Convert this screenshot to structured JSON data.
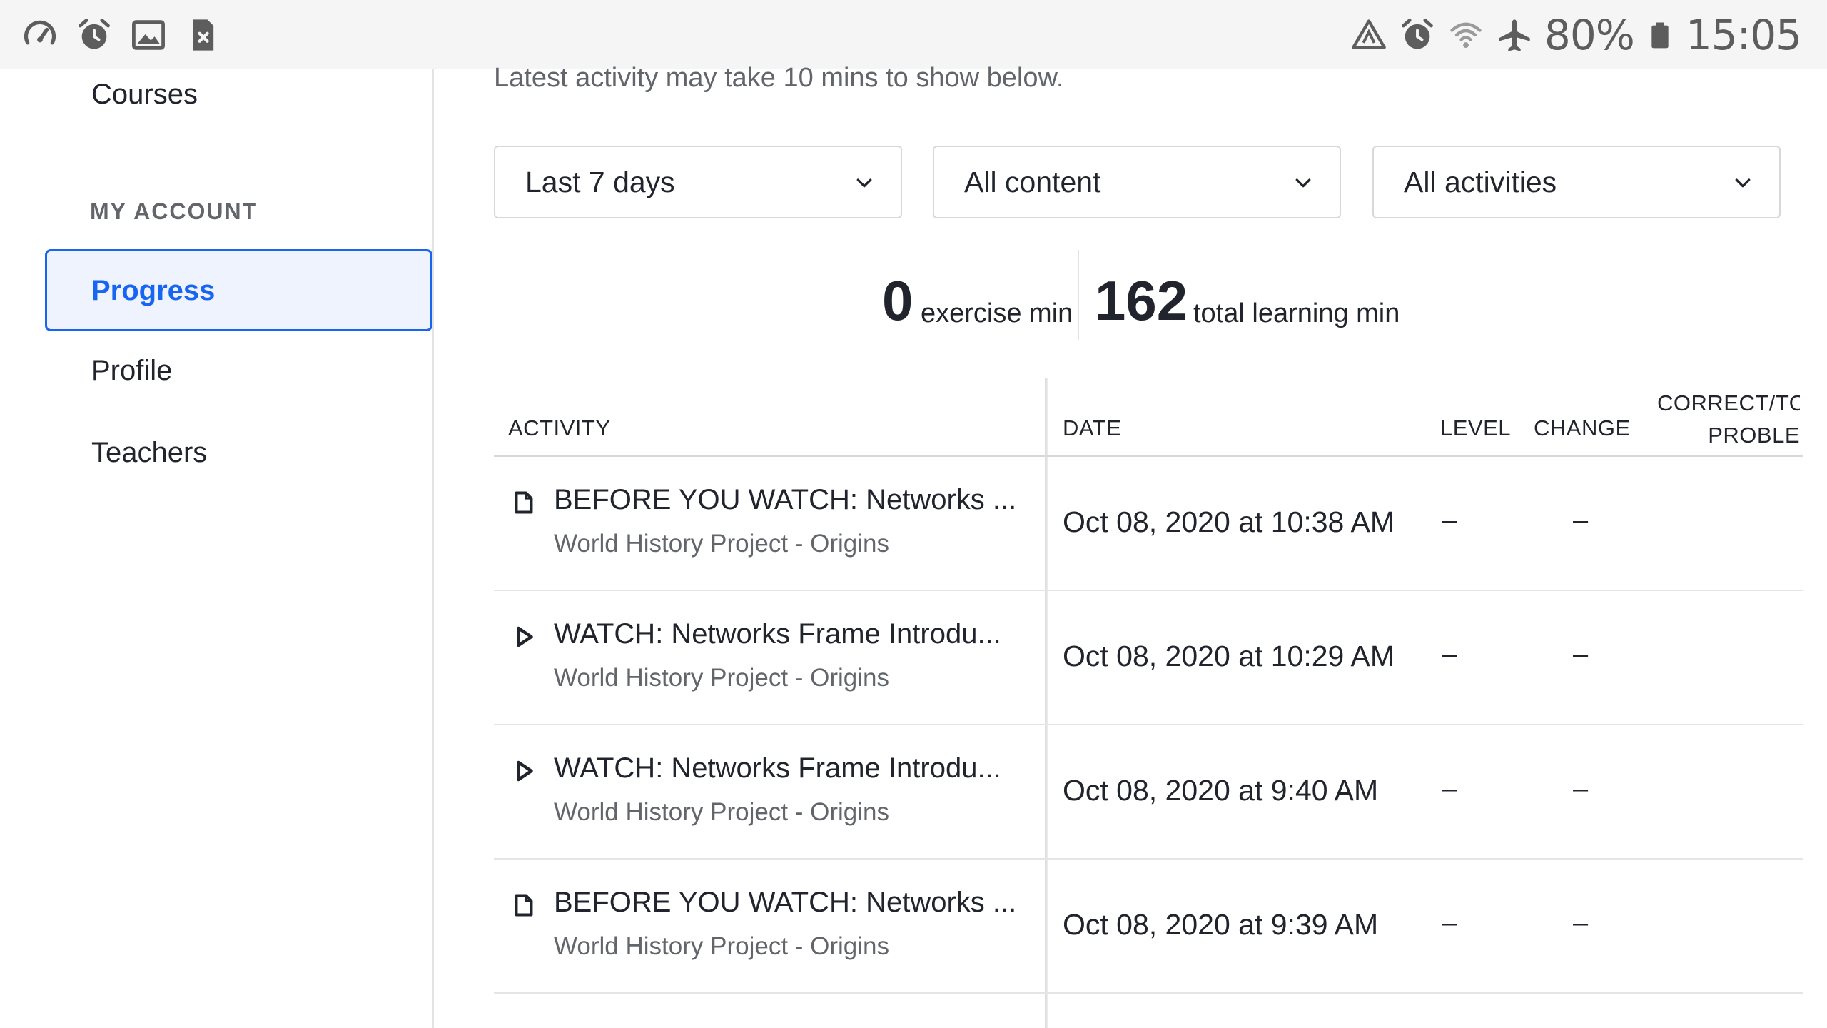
{
  "status_bar": {
    "left_icons": [
      "speedometer-icon",
      "alarm-icon",
      "image-icon",
      "sim-error-icon"
    ],
    "right_icons": [
      "data-saver-icon",
      "alarm-icon",
      "wifi-icon",
      "airplane-mode-icon",
      "battery-icon"
    ],
    "battery": "80%",
    "time": "15:05"
  },
  "sidebar": {
    "top_link": "Courses",
    "section_label": "MY ACCOUNT",
    "items": [
      {
        "label": "Progress",
        "active": true
      },
      {
        "label": "Profile",
        "active": false
      },
      {
        "label": "Teachers",
        "active": false
      }
    ]
  },
  "main": {
    "notice": "Latest activity may take 10 mins to show below.",
    "filters": [
      {
        "value": "Last 7 days"
      },
      {
        "value": "All content"
      },
      {
        "value": "All activities"
      }
    ],
    "summary": {
      "exercise_value": "0",
      "exercise_caption": "exercise min",
      "learning_value": "162",
      "learning_caption": "total learning min"
    },
    "table": {
      "headers": {
        "activity": "ACTIVITY",
        "date": "DATE",
        "level": "LEVEL",
        "change": "CHANGE",
        "correct_line1": "CORRECT/TOT",
        "correct_line2": "PROBLE"
      },
      "rows": [
        {
          "icon": "article-icon",
          "title": "BEFORE YOU WATCH: Networks ...",
          "subtitle": "World History Project - Origins",
          "date": "Oct 08, 2020 at 10:38 AM",
          "level": "–",
          "change": "–",
          "correct": ""
        },
        {
          "icon": "video-play-icon",
          "title": "WATCH: Networks Frame Introdu...",
          "subtitle": "World History Project - Origins",
          "date": "Oct 08, 2020 at 10:29 AM",
          "level": "–",
          "change": "–",
          "correct": ""
        },
        {
          "icon": "video-play-icon",
          "title": "WATCH: Networks Frame Introdu...",
          "subtitle": "World History Project - Origins",
          "date": "Oct 08, 2020 at 9:40 AM",
          "level": "–",
          "change": "–",
          "correct": ""
        },
        {
          "icon": "article-icon",
          "title": "BEFORE YOU WATCH: Networks ...",
          "subtitle": "World History Project - Origins",
          "date": "Oct 08, 2020 at 9:39 AM",
          "level": "–",
          "change": "–",
          "correct": ""
        }
      ]
    }
  }
}
